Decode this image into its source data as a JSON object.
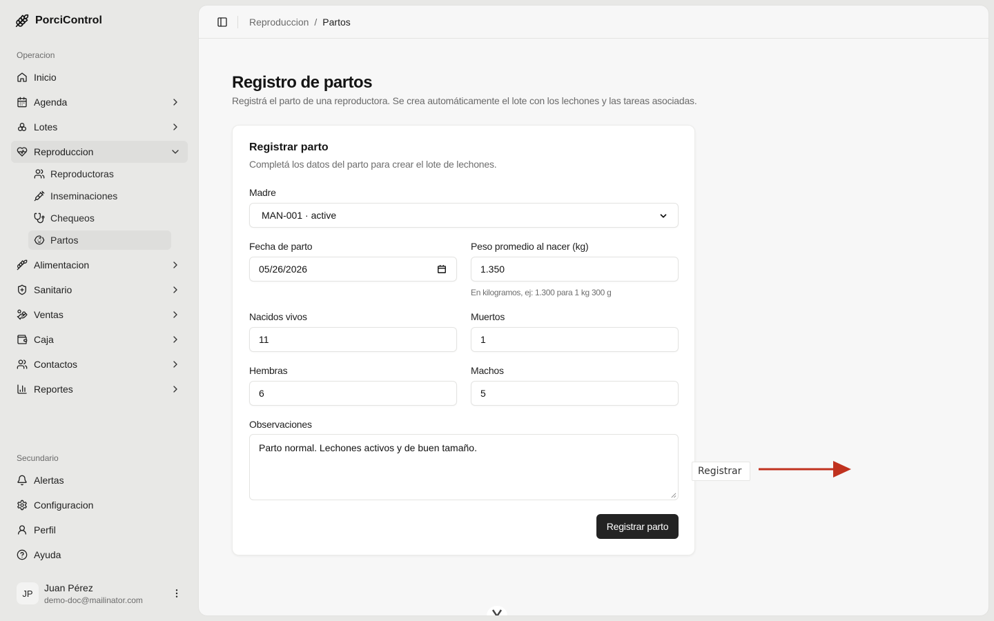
{
  "app": {
    "name": "PorciControl"
  },
  "sidebar": {
    "sections": [
      {
        "label": "Operacion"
      },
      {
        "label": "Secundario"
      }
    ],
    "items": [
      {
        "label": "Inicio",
        "icon": "home-icon"
      },
      {
        "label": "Agenda",
        "icon": "calendar-icon"
      },
      {
        "label": "Lotes",
        "icon": "boxes-icon"
      },
      {
        "label": "Reproduccion",
        "icon": "heart-pulse-icon"
      },
      {
        "label": "Alimentacion",
        "icon": "wheat-icon"
      },
      {
        "label": "Sanitario",
        "icon": "shield-icon"
      },
      {
        "label": "Ventas",
        "icon": "hand-coins-icon"
      },
      {
        "label": "Caja",
        "icon": "wallet-icon"
      },
      {
        "label": "Contactos",
        "icon": "users-icon"
      },
      {
        "label": "Reportes",
        "icon": "bar-chart-icon"
      }
    ],
    "subitems": [
      {
        "label": "Reproductoras",
        "icon": "users-icon"
      },
      {
        "label": "Inseminaciones",
        "icon": "syringe-icon"
      },
      {
        "label": "Chequeos",
        "icon": "stethoscope-icon"
      },
      {
        "label": "Partos",
        "icon": "baby-icon"
      }
    ],
    "secondary": [
      {
        "label": "Alertas",
        "icon": "bell-icon"
      },
      {
        "label": "Configuracion",
        "icon": "gear-icon"
      },
      {
        "label": "Perfil",
        "icon": "user-icon"
      },
      {
        "label": "Ayuda",
        "icon": "help-circle-icon"
      }
    ],
    "user": {
      "initials": "JP",
      "name": "Juan Pérez",
      "email": "demo-doc@mailinator.com"
    }
  },
  "breadcrumb": {
    "parent": "Reproduccion",
    "separator": "/",
    "current": "Partos"
  },
  "page": {
    "title": "Registro de partos",
    "description": "Registrá el parto de una reproductora. Se crea automáticamente el lote con los lechones y las tareas asociadas."
  },
  "form": {
    "title": "Registrar parto",
    "description": "Completá los datos del parto para crear el lote de lechones.",
    "madre": {
      "label": "Madre",
      "value": "MAN-001 · active"
    },
    "fecha": {
      "label": "Fecha de parto",
      "value": "05/26/2026"
    },
    "peso": {
      "label": "Peso promedio al nacer (kg)",
      "value": "1.350",
      "hint": "En kilogramos, ej: 1.300 para 1 kg 300 g"
    },
    "vivos": {
      "label": "Nacidos vivos",
      "value": "11"
    },
    "muertos": {
      "label": "Muertos",
      "value": "1"
    },
    "hembras": {
      "label": "Hembras",
      "value": "6"
    },
    "machos": {
      "label": "Machos",
      "value": "5"
    },
    "observaciones": {
      "label": "Observaciones",
      "value": "Parto normal. Lechones activos y de buen tamaño."
    },
    "submit_label": "Registrar parto"
  },
  "annotation": {
    "tooltip": "Registrar",
    "arrow_color": "#c0321f"
  }
}
